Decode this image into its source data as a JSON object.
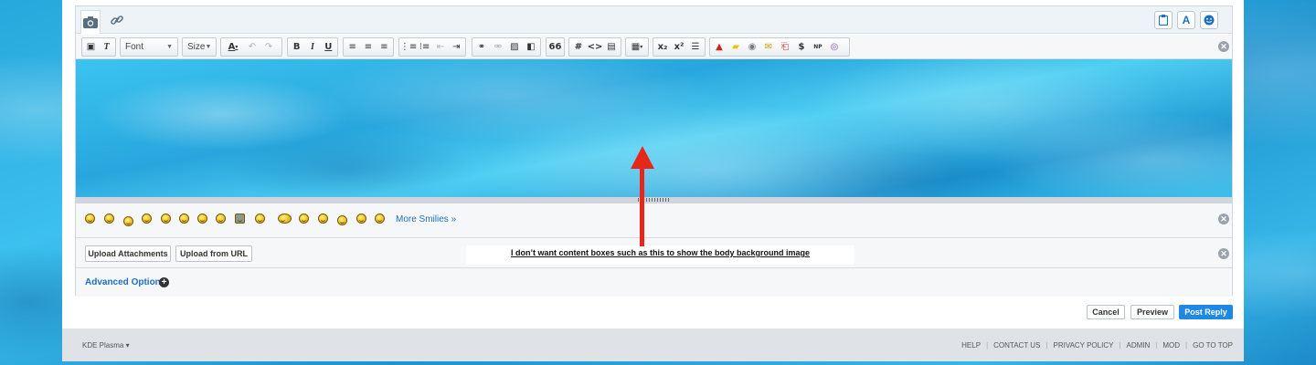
{
  "editor": {
    "tabs": [
      {
        "icon": "camera-icon"
      },
      {
        "icon": "link-icon"
      }
    ],
    "right_buttons": [
      "clipboard-icon",
      "A",
      "smiley-icon"
    ],
    "toolbar": {
      "font_label": "Font",
      "size_label": "Size",
      "bold": "B",
      "italic": "I",
      "underline": "U",
      "quote": "66",
      "hash": "#",
      "code": "<>",
      "subscript": "x₂",
      "superscript": "x²",
      "dollar": "$",
      "np": "NP"
    },
    "more_smilies": "More Smilies »",
    "upload_attachments": "Upload Attachments",
    "upload_from_url": "Upload from URL",
    "advanced_options": "Advanced Options"
  },
  "annotation": {
    "text": "I don’t want content boxes such as this to show the body  background image",
    "arrow_color": "#e8271c"
  },
  "actions": {
    "cancel": "Cancel",
    "preview": "Preview",
    "post_reply": "Post Reply"
  },
  "footer": {
    "style_chooser": "KDE Plasma ▾",
    "links": [
      "HELP",
      "CONTACT US",
      "PRIVACY POLICY",
      "ADMIN",
      "MOD",
      "GO TO TOP"
    ]
  },
  "colors": {
    "accent": "#1e88e5",
    "link": "#1d6fc4"
  }
}
